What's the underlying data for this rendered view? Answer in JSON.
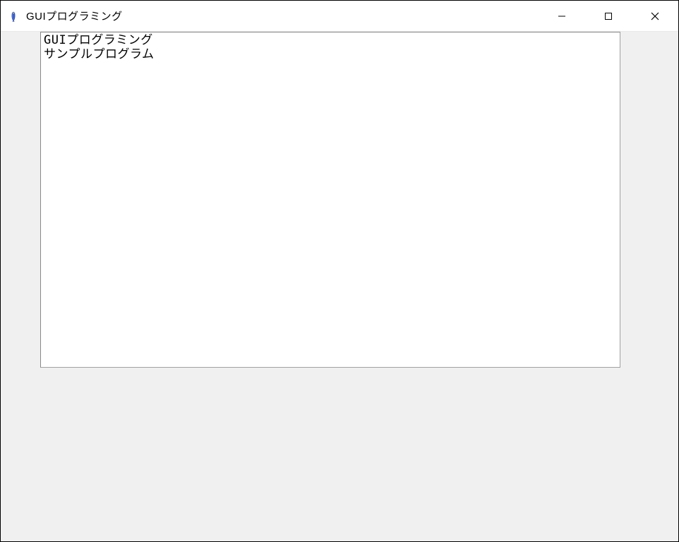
{
  "window": {
    "title": "GUIプログラミング"
  },
  "text_widget": {
    "line1": "GUIプログラミング",
    "line2": "サンプルプログラム"
  }
}
